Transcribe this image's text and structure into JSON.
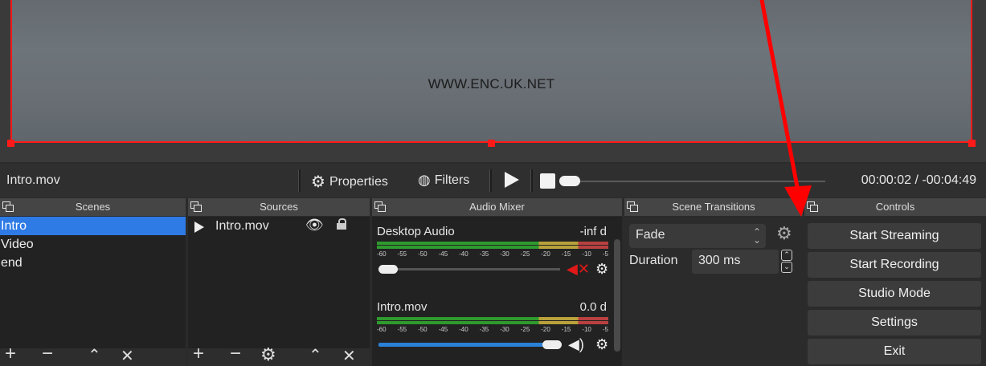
{
  "preview": {
    "watermark": "WWW.ENC.UK.NET"
  },
  "context_bar": {
    "source_name": "Intro.mov",
    "properties_label": "Properties",
    "filters_label": "Filters",
    "time": "00:00:02 / -00:04:49"
  },
  "docks": {
    "scenes": {
      "title": "Scenes",
      "items": [
        "Intro",
        "Video",
        "end"
      ],
      "selected": "Intro"
    },
    "sources": {
      "title": "Sources",
      "items": [
        {
          "name": "Intro.mov"
        }
      ]
    },
    "mixer": {
      "title": "Audio Mixer",
      "channels": [
        {
          "name": "Desktop Audio",
          "level": "-inf d",
          "muted": true
        },
        {
          "name": "Intro.mov",
          "level": "0.0 d",
          "muted": false
        }
      ],
      "scale": [
        "-60",
        "-55",
        "-50",
        "-45",
        "-40",
        "-35",
        "-30",
        "-25",
        "-20",
        "-15",
        "-10",
        "-5"
      ]
    },
    "transitions": {
      "title": "Scene Transitions",
      "selected": "Fade",
      "duration_label": "Duration",
      "duration_value": "300 ms"
    },
    "controls": {
      "title": "Controls",
      "buttons": [
        "Start Streaming",
        "Start Recording",
        "Studio Mode",
        "Settings",
        "Exit"
      ]
    }
  },
  "colors": {
    "accent": "#2e7be6",
    "selection_border": "#ff1a1a",
    "annotation": "#ff0000"
  },
  "icons": {
    "properties": "gear-icon",
    "filters": "filters-icon",
    "visibility": "eye-icon",
    "lock": "lock-icon",
    "speaker": "speaker-icon",
    "muted": "muted-speaker-icon"
  }
}
